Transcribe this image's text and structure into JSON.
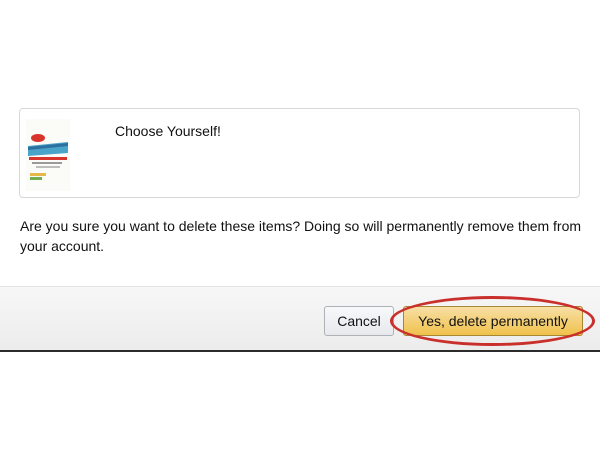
{
  "item": {
    "title": "Choose Yourself!",
    "cover_icon": "book-cover-thumbnail"
  },
  "confirm": {
    "message": "Are you sure you want to delete these items? Doing so will permanently remove them from your account."
  },
  "buttons": {
    "cancel_label": "Cancel",
    "delete_label": "Yes, delete permanently"
  },
  "colors": {
    "delete_button": "#f0c14b",
    "highlight_ring": "#c9302c"
  }
}
